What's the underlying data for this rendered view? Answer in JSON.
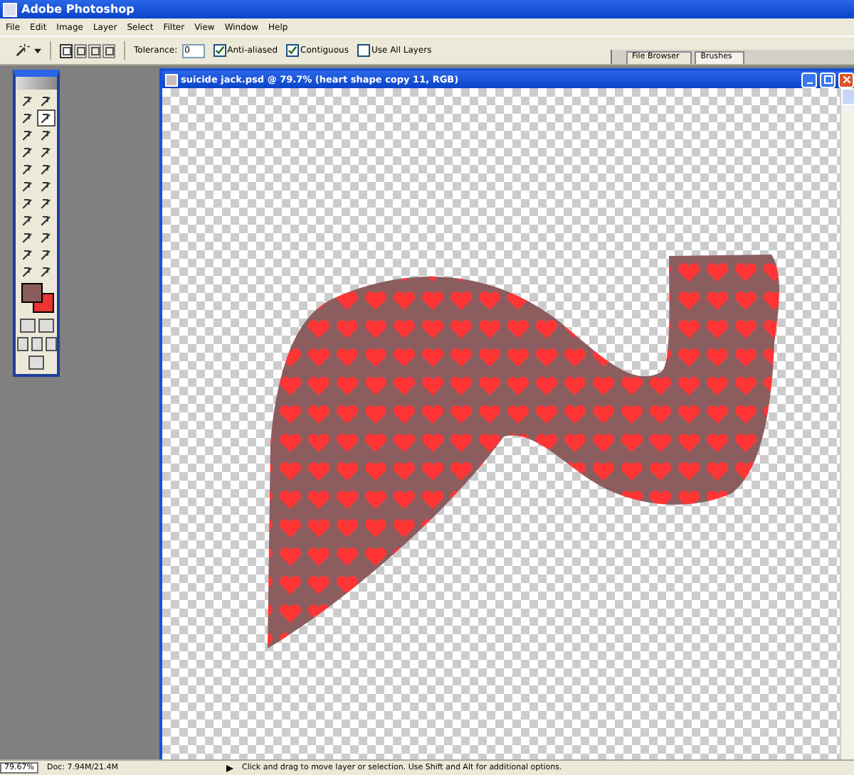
{
  "window": {
    "title": "Adobe Photoshop"
  },
  "menu": [
    "File",
    "Edit",
    "Image",
    "Layer",
    "Select",
    "Filter",
    "View",
    "Window",
    "Help"
  ],
  "options_bar": {
    "selection_modes": [
      {
        "selected": true
      },
      {
        "selected": false
      },
      {
        "selected": false
      },
      {
        "selected": false
      }
    ],
    "tolerance": {
      "label": "Tolerance:",
      "value": "0"
    },
    "checkboxes": [
      {
        "label": "Anti-aliased",
        "checked": true
      },
      {
        "label": "Contiguous",
        "checked": true
      },
      {
        "label": "Use All Layers",
        "checked": false
      }
    ],
    "palette_tabs": [
      {
        "label": "File Browser",
        "selected": false
      },
      {
        "label": "Brushes",
        "selected": true
      }
    ]
  },
  "document": {
    "title": "suicide jack.psd @ 79.7% (heart shape copy 11, RGB)"
  },
  "status_bar": {
    "zoom": "79.67%",
    "doc": "Doc: 7.94M/21.4M",
    "hint": "Click and drag to move layer or selection. Use Shift and Alt for additional options."
  }
}
